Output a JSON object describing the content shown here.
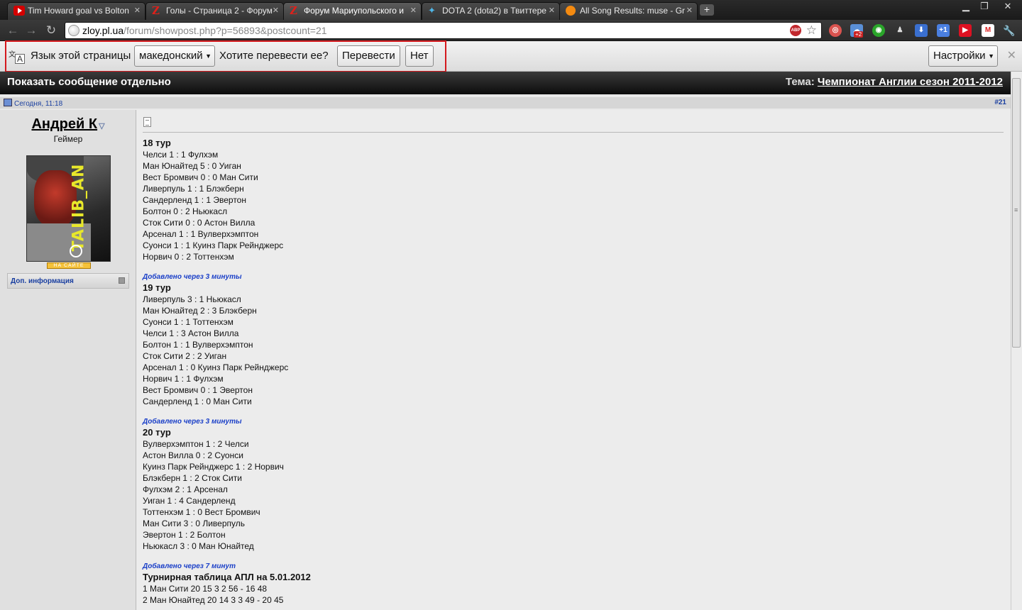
{
  "tabs": [
    {
      "title": "Tim Howard goal vs Bolton",
      "icon": "youtube-icon"
    },
    {
      "title": "Голы - Страница 2 - Форум",
      "icon": "zloy-icon"
    },
    {
      "title": "Форум Мариупольского и",
      "icon": "zloy-icon"
    },
    {
      "title": "DOTA 2 (dota2) в Твиттере",
      "icon": "twitter-icon"
    },
    {
      "title": "All Song Results: muse - Gr",
      "icon": "grooveshark-icon"
    }
  ],
  "address": {
    "host": "zloy.pl.ua",
    "path": "/forum/showpost.php?p=56893&postcount=21"
  },
  "extensions": {
    "badge_count": "+2",
    "gplus": "+1"
  },
  "translate": {
    "language_label": "Язык этой страницы",
    "language_value": "македонский",
    "question": "Хотите перевести ее?",
    "translate_button": "Перевести",
    "no_button": "Нет",
    "settings_button": "Настройки"
  },
  "page": {
    "header_left": "Показать сообщение отдельно",
    "topic_label": "Тема:",
    "topic_link": "Чемпионат Англии сезон 2011-2012",
    "post_date": "Сегодня, 11:18",
    "post_number": "#21"
  },
  "user": {
    "name": "Андрей К",
    "title": "Геймер",
    "avatar_text": "TALIB_AN",
    "online_badge": "НА САЙТЕ",
    "more_info": "Доп. информация"
  },
  "post": {
    "rounds": [
      {
        "added": "",
        "title": "18 тур",
        "matches": [
          "Челси 1 : 1 Фулхэм",
          "Ман Юнайтед 5 : 0 Уиган",
          "Вест Бромвич 0 : 0 Ман Сити",
          "Ливерпуль 1 : 1 Блэкберн",
          "Сандерленд 1 : 1 Эвертон",
          "Болтон 0 : 2 Ньюкасл",
          "Сток Сити 0 : 0 Астон Вилла",
          "Арсенал 1 : 1 Вулверхэмптон",
          "Суонси 1 : 1 Куинз Парк Рейнджерс",
          "Норвич 0 : 2 Тоттенхэм"
        ]
      },
      {
        "added": "Добавлено через 3 минуты",
        "title": "19 тур",
        "matches": [
          "Ливерпуль 3 : 1 Ньюкасл",
          "Ман Юнайтед 2 : 3 Блэкберн",
          "Суонси 1 : 1 Тоттенхэм",
          "Челси 1 : 3 Астон Вилла",
          "Болтон 1 : 1 Вулверхэмптон",
          "Сток Сити 2 : 2 Уиган",
          "Арсенал 1 : 0 Куинз Парк Рейнджерс",
          "Норвич 1 : 1 Фулхэм",
          "Вест Бромвич 0 : 1 Эвертон",
          "Сандерленд 1 : 0 Ман Сити"
        ]
      },
      {
        "added": "Добавлено через 3 минуты",
        "title": "20 тур",
        "matches": [
          "Вулверхэмптон 1 : 2 Челси",
          "Астон Вилла 0 : 2 Суонси",
          "Куинз Парк Рейнджерс 1 : 2 Норвич",
          "Блэкберн 1 : 2 Сток Сити",
          "Фулхэм 2 : 1 Арсенал",
          "Уиган 1 : 4 Сандерленд",
          "Тоттенхэм 1 : 0 Вест Бромвич",
          "Ман Сити 3 : 0 Ливерпуль",
          "Эвертон 1 : 2 Болтон",
          "Ньюкасл 3 : 0 Ман Юнайтед"
        ]
      },
      {
        "added": "Добавлено через 7 минут",
        "title": "Турнирная таблица АПЛ на 5.01.2012",
        "matches": [
          "1 Ман Сити 20 15 3 2 56 - 16 48",
          "2 Ман Юнайтед 20 14 3 3 49 - 20 45"
        ]
      }
    ]
  }
}
